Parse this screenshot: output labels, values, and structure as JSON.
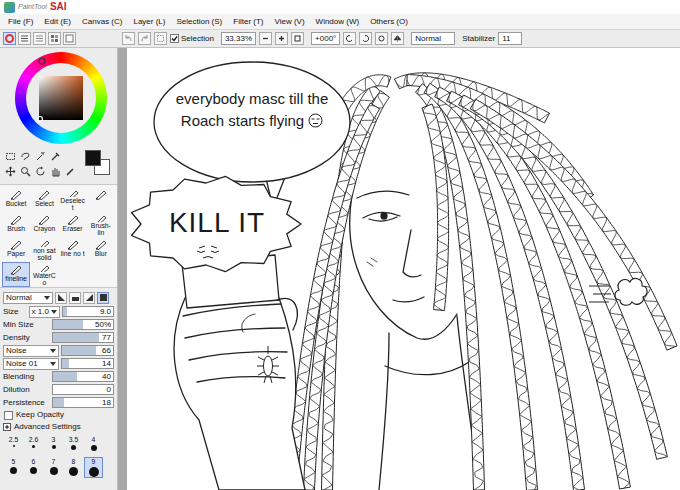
{
  "app": {
    "brand": "PaintTool",
    "name": "SAI"
  },
  "menu": [
    "File (F)",
    "Edit (E)",
    "Canvas (C)",
    "Layer (L)",
    "Selection (S)",
    "Filter (T)",
    "View (V)",
    "Window (W)",
    "Others (O)"
  ],
  "toolbar": {
    "selection": {
      "label": "Selection",
      "checked": true
    },
    "zoom": "33.33%",
    "rotation": "+000°",
    "blend_mode": "Normal",
    "stabilizer": {
      "label": "Stabilizer",
      "value": "11"
    }
  },
  "colors": {
    "foreground": "#111111",
    "background": "#ffffff"
  },
  "brushes": [
    {
      "label": "Bucket",
      "selected": false
    },
    {
      "label": "Select",
      "selected": false
    },
    {
      "label": "Deselect",
      "selected": false
    },
    {
      "label": "",
      "selected": false
    },
    {
      "label": "Brush",
      "selected": false
    },
    {
      "label": "Crayon",
      "selected": false
    },
    {
      "label": "Eraser",
      "selected": false
    },
    {
      "label": "Brush-lin",
      "selected": false
    },
    {
      "label": "Paper",
      "selected": false
    },
    {
      "label": "non sat solid",
      "selected": false
    },
    {
      "label": "line no t",
      "selected": false
    },
    {
      "label": "Blur",
      "selected": false
    },
    {
      "label": "fineline",
      "selected": true
    },
    {
      "label": "WaterCo",
      "selected": false
    }
  ],
  "brush_settings": {
    "mode": "Normal",
    "tip_shapes": [
      {
        "selected": false
      },
      {
        "selected": false
      },
      {
        "selected": false
      },
      {
        "selected": true
      }
    ],
    "size": {
      "label": "Size",
      "multiplier": "x 1.0",
      "value": "9.0",
      "level": 0.09
    },
    "rows": [
      {
        "kind": "slider",
        "label": "Min Size",
        "value": "50%",
        "level": 0.5
      },
      {
        "kind": "slider",
        "label": "Density",
        "value": "77",
        "level": 0.77
      },
      {
        "kind": "dropdown",
        "label": "Noise",
        "value": "66",
        "level": 0.66
      },
      {
        "kind": "dropdown",
        "label": "Noise 01",
        "value": "14",
        "level": 0.14
      },
      {
        "kind": "slider",
        "label": "Blending",
        "value": "40",
        "level": 0.4
      },
      {
        "kind": "slider",
        "label": "Dilution",
        "value": "0",
        "level": 0
      },
      {
        "kind": "slider",
        "label": "Persistence",
        "value": "18",
        "level": 0.18
      }
    ],
    "keep_opacity": {
      "label": "Keep Opacity",
      "checked": false
    },
    "advanced": "Advanced Settings"
  },
  "brush_sizes": [
    {
      "label": "2.5",
      "selected": false
    },
    {
      "label": "2.6",
      "selected": false
    },
    {
      "label": "3",
      "selected": false
    },
    {
      "label": "3.5",
      "selected": false
    },
    {
      "label": "4",
      "selected": false
    },
    {
      "label": "5",
      "selected": false
    },
    {
      "label": "6",
      "selected": false
    },
    {
      "label": "7",
      "selected": false
    },
    {
      "label": "8",
      "selected": false
    },
    {
      "label": "9",
      "selected": true
    }
  ],
  "canvas": {
    "bubbles": [
      {
        "text": "everybody masc till the Roach starts flying"
      },
      {
        "text": "KILL IT"
      }
    ]
  }
}
